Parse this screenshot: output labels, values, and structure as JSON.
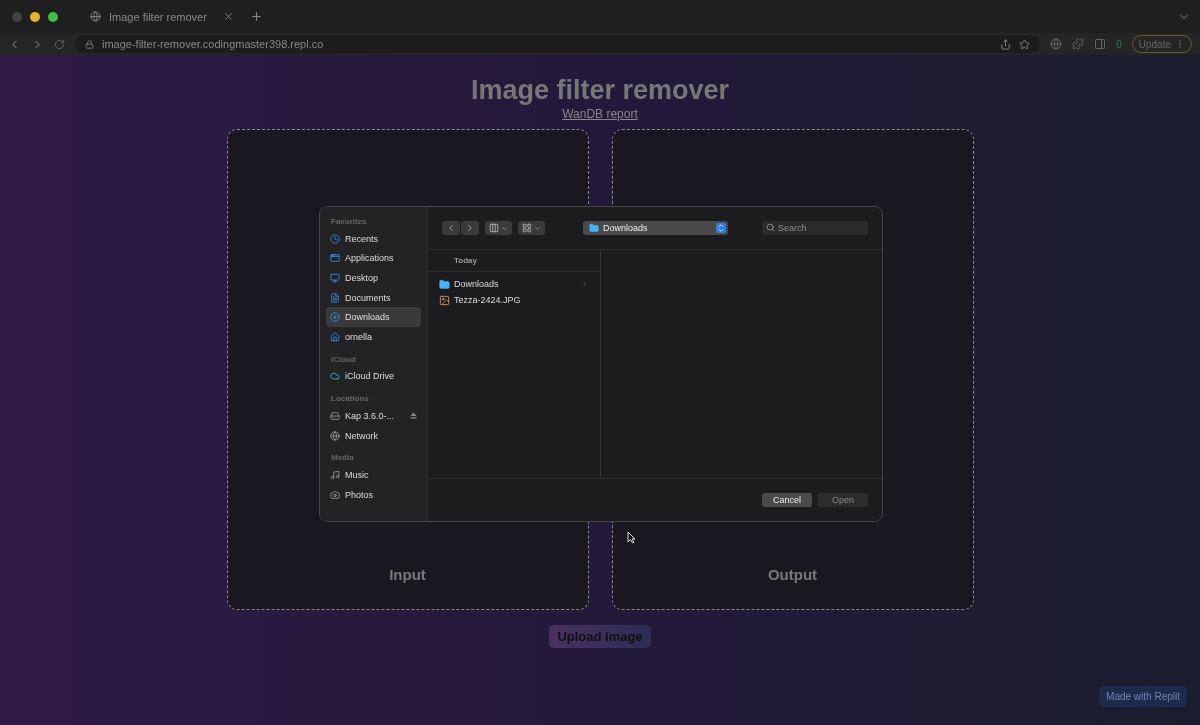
{
  "browser": {
    "tab_title": "Image filter remover",
    "url": "image-filter-remover.codingmaster398.repl.co",
    "extension_badge": "0",
    "update_label": "Update"
  },
  "page": {
    "title": "Image filter remover",
    "link": "WanDB report",
    "panels": [
      "Input",
      "Output"
    ],
    "upload_button": "Upload image",
    "replit_badge": "Made with Replit"
  },
  "dialog": {
    "sidebar": [
      {
        "heading": "Favorites",
        "items": [
          {
            "label": "Recents",
            "selected": false,
            "eject": false
          },
          {
            "label": "Applications",
            "selected": false,
            "eject": false
          },
          {
            "label": "Desktop",
            "selected": false,
            "eject": false
          },
          {
            "label": "Documents",
            "selected": false,
            "eject": false
          },
          {
            "label": "Downloads",
            "selected": true,
            "eject": false
          },
          {
            "label": "ornella",
            "selected": false,
            "eject": false
          }
        ]
      },
      {
        "heading": "iCloud",
        "items": [
          {
            "label": "iCloud Drive",
            "selected": false,
            "eject": false
          }
        ]
      },
      {
        "heading": "Locations",
        "items": [
          {
            "label": "Kap 3.6.0-...",
            "selected": false,
            "eject": true
          },
          {
            "label": "Network",
            "selected": false,
            "eject": false
          }
        ]
      },
      {
        "heading": "Media",
        "items": [
          {
            "label": "Music",
            "selected": false,
            "eject": false
          },
          {
            "label": "Photos",
            "selected": false,
            "eject": false
          }
        ]
      }
    ],
    "location": "Downloads",
    "search_placeholder": "Search",
    "column_heading": "Today",
    "files": [
      {
        "name": "Downloads",
        "kind": "folder"
      },
      {
        "name": "Tezza-2424.JPG",
        "kind": "image"
      }
    ],
    "buttons": [
      {
        "label": "Cancel",
        "disabled": false
      },
      {
        "label": "Open",
        "disabled": true
      }
    ]
  }
}
